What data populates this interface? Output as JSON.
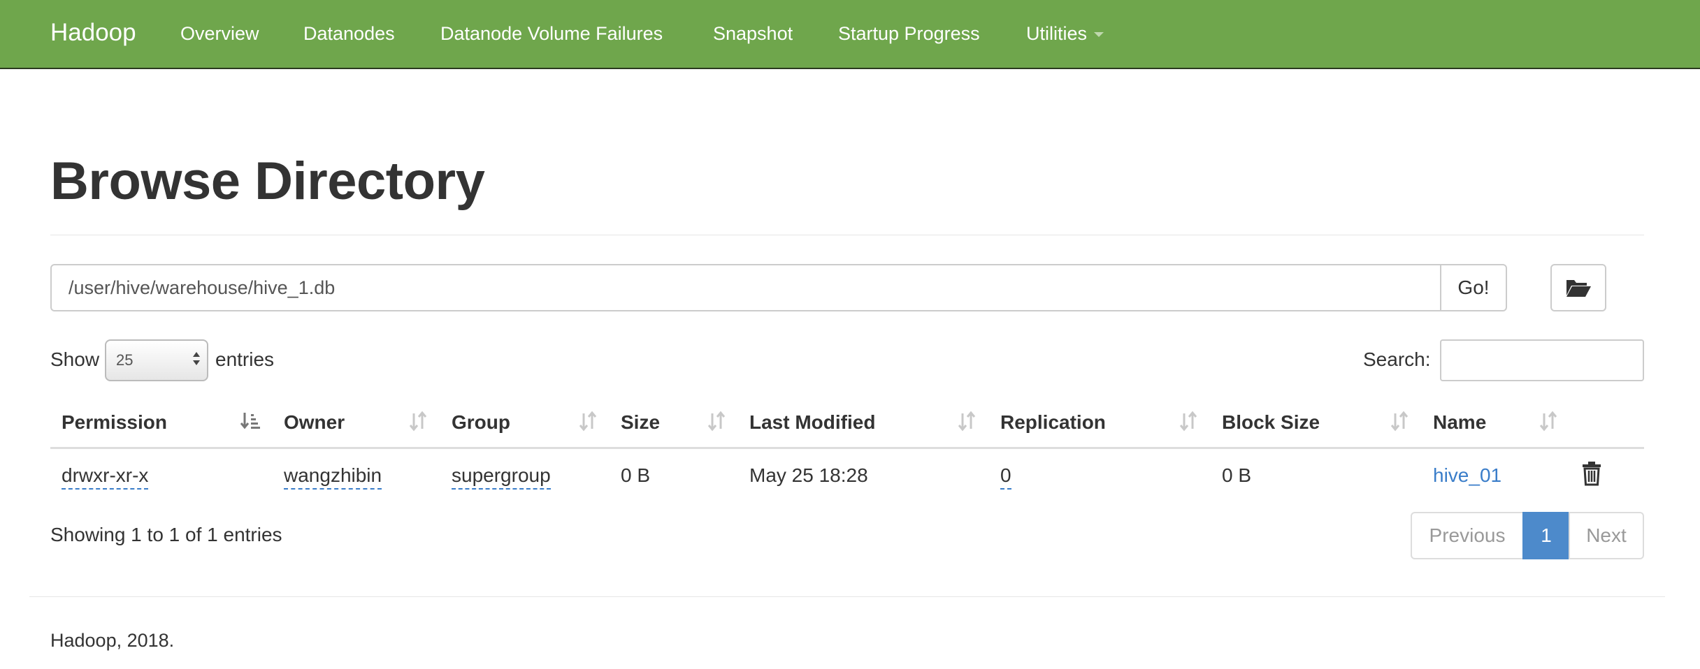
{
  "navbar": {
    "brand": "Hadoop",
    "items": [
      "Overview",
      "Datanodes",
      "Datanode Volume Failures",
      "Snapshot",
      "Startup Progress",
      "Utilities"
    ]
  },
  "page": {
    "title": "Browse Directory"
  },
  "path_bar": {
    "value": "/user/hive/warehouse/hive_1.db",
    "go_label": "Go!"
  },
  "table_controls": {
    "show_label": "Show",
    "page_length": "25",
    "entries_label": "entries",
    "search_label": "Search:",
    "search_value": ""
  },
  "table": {
    "columns": [
      "Permission",
      "Owner",
      "Group",
      "Size",
      "Last Modified",
      "Replication",
      "Block Size",
      "Name"
    ],
    "rows": [
      {
        "permission": "drwxr-xr-x",
        "owner": "wangzhibin",
        "group": "supergroup",
        "size": "0 B",
        "last_modified": "May 25 18:28",
        "replication": "0",
        "block_size": "0 B",
        "name": "hive_01"
      }
    ]
  },
  "table_info": "Showing 1 to 1 of 1 entries",
  "pagination": {
    "previous": "Previous",
    "current": "1",
    "next": "Next"
  },
  "footer": {
    "text": "Hadoop, 2018."
  },
  "colors": {
    "navbar": "#6fa64c",
    "link": "#3a7dc9",
    "active_page": "#4d8acb"
  },
  "icons": {
    "folder": "folder-open-icon",
    "delete": "trash-icon",
    "sort": "sort-icon"
  }
}
